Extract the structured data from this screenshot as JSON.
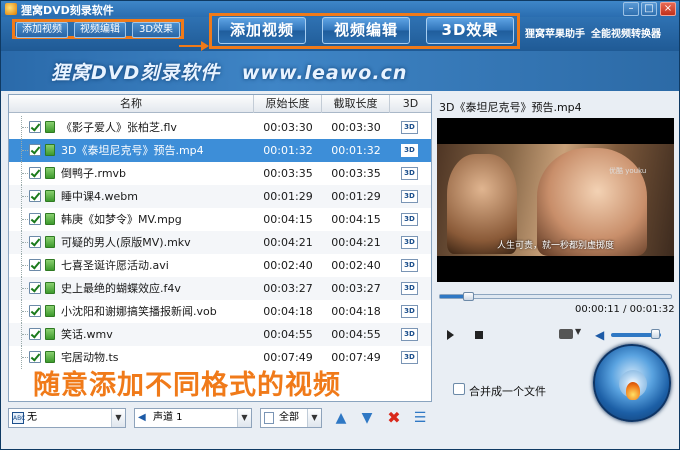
{
  "window": {
    "title": "狸窝DVD刻录软件",
    "controls": {
      "minimize": "–",
      "maximize": "□",
      "close": "×"
    }
  },
  "menu": {
    "small_buttons": [
      "添加视频",
      "视频编辑",
      "3D效果"
    ],
    "big_buttons": [
      "添加视频",
      "视频编辑",
      "3D效果"
    ],
    "links": [
      "狸窝苹果助手",
      "全能视频转换器"
    ]
  },
  "banner": {
    "title": "狸窝DVD刻录软件",
    "url": "www.leawo.cn"
  },
  "file_list": {
    "columns": [
      "名称",
      "原始长度",
      "截取长度",
      "3D"
    ],
    "rows": [
      {
        "name": "《影子爱人》张柏芝.flv",
        "original": "00:03:30",
        "cut": "00:03:30",
        "d3": "3D",
        "selected": false
      },
      {
        "name": "3D《泰坦尼克号》预告.mp4",
        "original": "00:01:32",
        "cut": "00:01:32",
        "d3": "3D",
        "selected": true
      },
      {
        "name": "倒鸭子.rmvb",
        "original": "00:03:35",
        "cut": "00:03:35",
        "d3": "3D",
        "selected": false
      },
      {
        "name": "睡中课4.webm",
        "original": "00:01:29",
        "cut": "00:01:29",
        "d3": "3D",
        "selected": false
      },
      {
        "name": "韩庚《如梦令》MV.mpg",
        "original": "00:04:15",
        "cut": "00:04:15",
        "d3": "3D",
        "selected": false
      },
      {
        "name": "可疑的男人(原版MV).mkv",
        "original": "00:04:21",
        "cut": "00:04:21",
        "d3": "3D",
        "selected": false
      },
      {
        "name": "七喜圣诞许愿活动.avi",
        "original": "00:02:40",
        "cut": "00:02:40",
        "d3": "3D",
        "selected": false
      },
      {
        "name": "史上最绝的蝴蝶效应.f4v",
        "original": "00:03:27",
        "cut": "00:03:27",
        "d3": "3D",
        "selected": false
      },
      {
        "name": "小沈阳和谢娜搞笑播报新闻.vob",
        "original": "00:04:18",
        "cut": "00:04:18",
        "d3": "3D",
        "selected": false
      },
      {
        "name": "笑话.wmv",
        "original": "00:04:55",
        "cut": "00:04:55",
        "d3": "3D",
        "selected": false
      },
      {
        "name": "宅居动物.ts",
        "original": "00:07:49",
        "cut": "00:07:49",
        "d3": "3D",
        "selected": false
      }
    ],
    "promo_text": "随意添加不同格式的视频"
  },
  "bottom_bar": {
    "subtitle_value": "无",
    "subtitle_icon_text": "ABC",
    "audio_value": "声道 1",
    "scope_value": "全部"
  },
  "preview": {
    "title": "3D《泰坦尼克号》预告.mp4",
    "subtitle": "人生可贵，就一秒都别虚掷度",
    "watermark": "优酷 youku",
    "time_display": "00:00:11 / 00:01:32",
    "progress": 0.12,
    "volume": 1.0,
    "merge_label": "合并成一个文件"
  },
  "colors": {
    "accent": "#f07a19",
    "selection": "#3d8ed8",
    "titlebar": "#2a6db0"
  }
}
